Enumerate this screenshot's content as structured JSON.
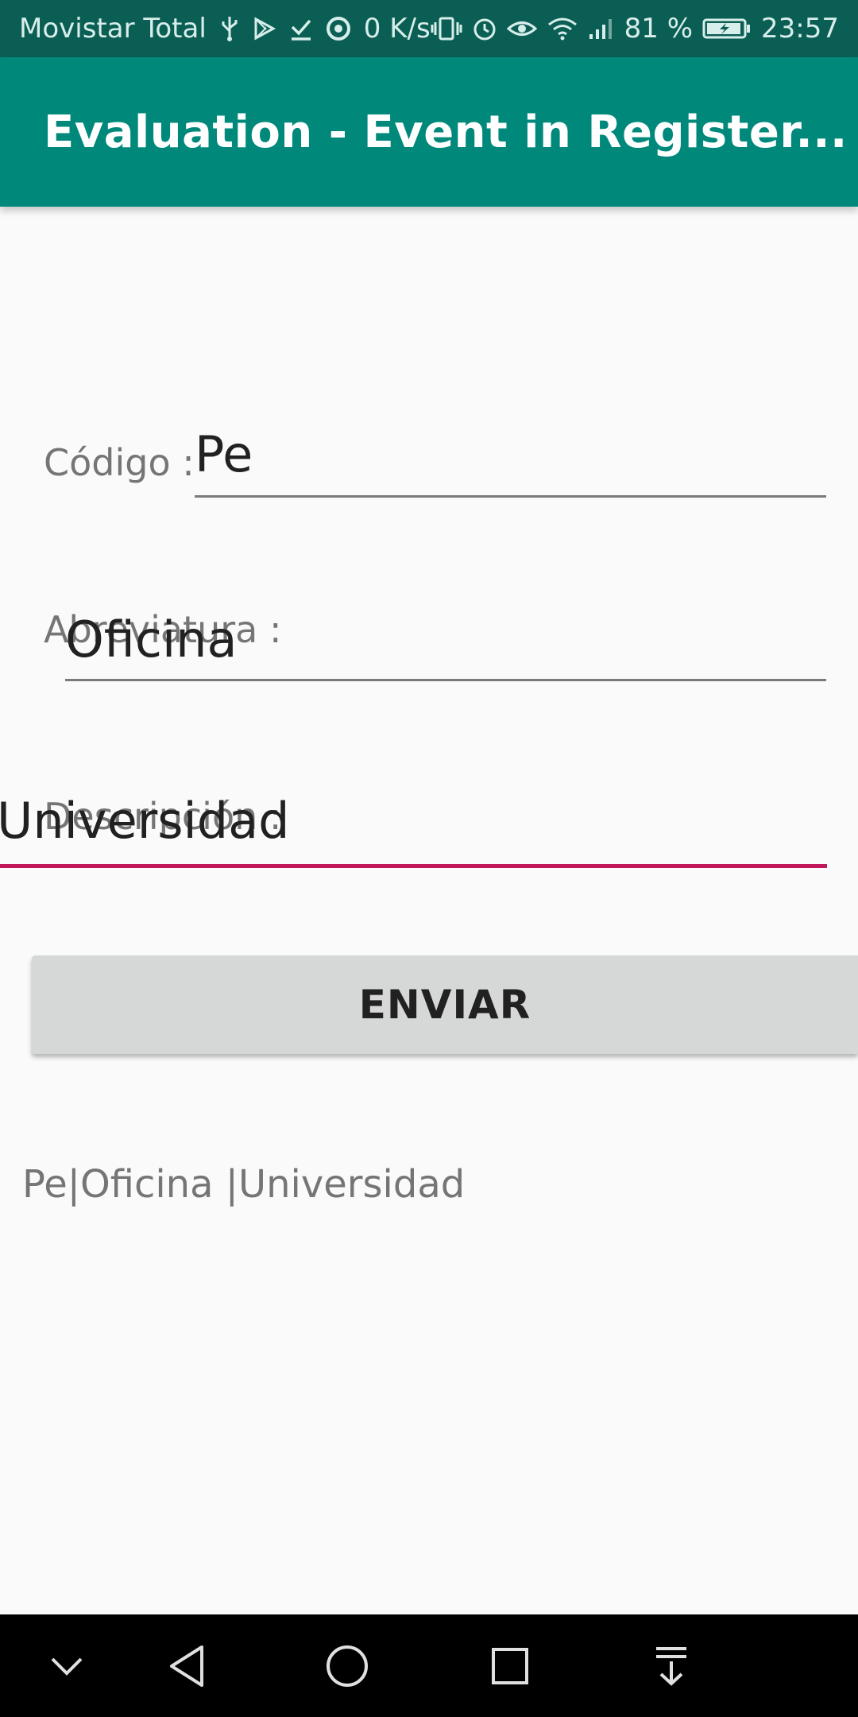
{
  "status_bar": {
    "carrier": "Movistar Total",
    "net_speed": "0 K/s",
    "battery": "81 %",
    "time": "23:57",
    "icons": [
      "usb-icon",
      "play-store-icon",
      "download-done-icon",
      "chrome-icon",
      "vibrate-icon",
      "alarm-icon",
      "eye-icon",
      "wifi-icon",
      "signal-icon",
      "battery-charging-icon"
    ]
  },
  "app_bar": {
    "title": "Evaluation - Event in Register...",
    "color": "#00897b"
  },
  "form": {
    "codigo": {
      "label": "Código :",
      "value": "Pe"
    },
    "abreviatura": {
      "label": "Abreviatura :",
      "value": "Oficina"
    },
    "descripcion": {
      "label": "Descripción :",
      "value": "Universidad"
    },
    "submit_label": "ENVIAR",
    "accent_color": "#c2185b"
  },
  "result": {
    "text": "Pe|Oficina |Universidad"
  },
  "nav_bar": {
    "buttons": [
      "chevron-down-icon",
      "back-icon",
      "home-icon",
      "recents-icon",
      "notification-pull-icon"
    ]
  }
}
